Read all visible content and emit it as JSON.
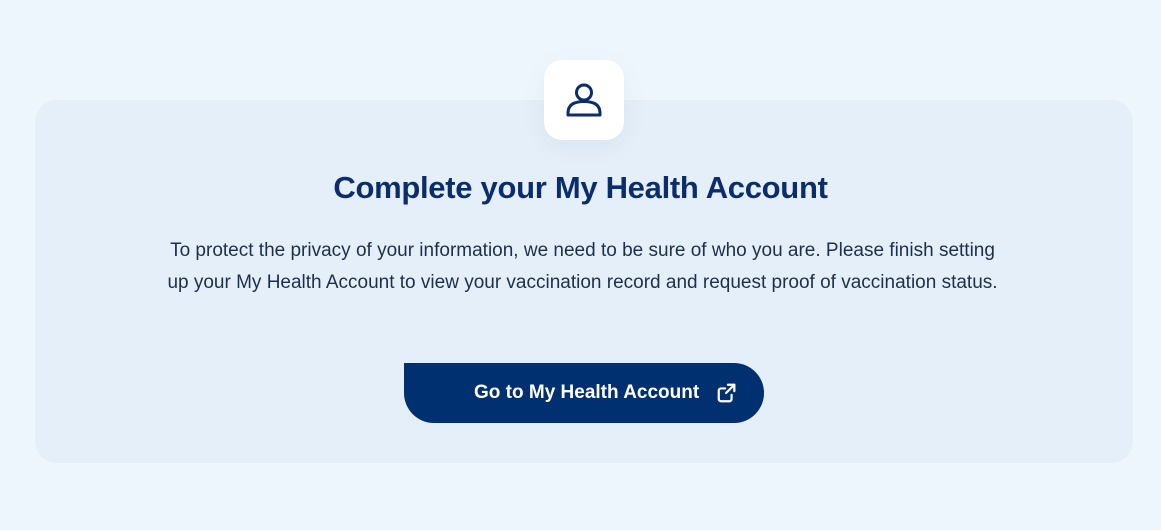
{
  "card": {
    "title": "Complete your My Health Account",
    "description": "To protect the privacy of your information, we need to be sure of who you are. Please finish setting up your My Health Account to view your vaccination record and request proof of vaccination status.",
    "button": {
      "label": "Go to My Health Account",
      "icon": "external-link-icon"
    },
    "avatar_icon": "user-icon"
  },
  "colors": {
    "page_background": "#eef6fd",
    "card_background": "#e4eff9",
    "primary": "#00306f",
    "title_text": "#0b2d6b",
    "body_text": "#1f2f4a"
  }
}
